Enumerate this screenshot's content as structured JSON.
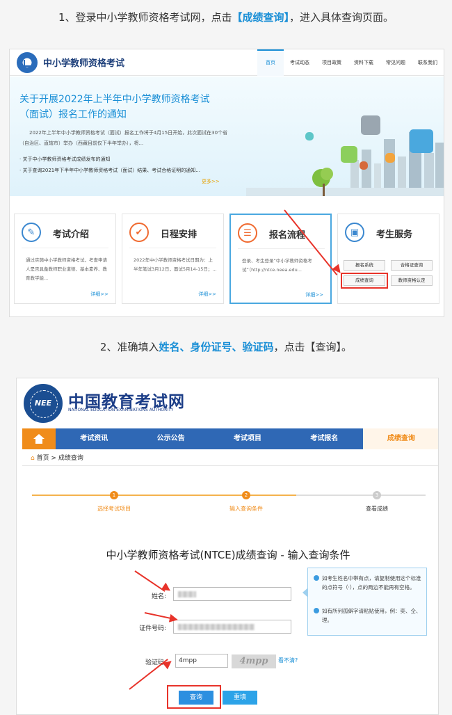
{
  "instructions": {
    "step1_prefix": "1、登录中小学教师资格考试网，点击",
    "step1_highlight": "【成绩查询】",
    "step1_suffix": "，进入具体查询页面。",
    "step2_prefix": "2、准确填入",
    "step2_name": "姓名",
    "step2_sep1": "、",
    "step2_id": "身份证号",
    "step2_sep2": "、",
    "step2_captcha": "验证码",
    "step2_suffix": "，点击【查询】。"
  },
  "shot1": {
    "site_title": "中小学教师资格考试",
    "nav": [
      "首页",
      "考试动态",
      "项目政策",
      "资料下载",
      "常见问题",
      "联系我们"
    ],
    "headline": "关于开展2022年上半年中小学教师资格考试（面试）报名工作的通知",
    "desc": "2022年上半年中小学教师资格考试（面试）报名工作将于4月15日开始，此次面试在30个省（自治区、直辖市）举办（西藏目前仅下半年举办），将...",
    "news": [
      "· 关于中小学教师资格考试成绩发布的通知",
      "· 关于查询2021年下半年中小学教师资格考试（面试）结果、考试合格证明的通知..."
    ],
    "more": "更多>>",
    "cards": [
      {
        "title": "考试介绍",
        "desc": "通过实施中小学教师资格考试，考查申请人是否具备教师职业道德、基本素养、教育教学能...",
        "more": "详细>>"
      },
      {
        "title": "日程安排",
        "desc": "2022年中小学教师资格考试日期为：上半年笔试3月12日，面试5月14-15日；...",
        "more": "详细>>"
      },
      {
        "title": "报名流程",
        "desc": "登录、考生登录“中小学教师资格考试”（http://ntce.neea.edu...",
        "more": "详细>>"
      },
      {
        "title": "考生服务"
      }
    ],
    "services": [
      "报名系统",
      "合格证查询",
      "成绩查询",
      "教师资格认定"
    ]
  },
  "shot2": {
    "brand": "中国教育考试网",
    "brand_en": "NATIONAL EDUCATION EXAMINATIONS AUTHORITY",
    "emblem_text": "NEE",
    "nav": [
      "考试资讯",
      "公示公告",
      "考试项目",
      "考试报名",
      "成绩查询"
    ],
    "breadcrumb_home": "首页",
    "breadcrumb_current": "成绩查询",
    "steps": [
      {
        "num": "1",
        "label": "选择考试项目"
      },
      {
        "num": "2",
        "label": "输入查询条件"
      },
      {
        "num": "3",
        "label": "查看成绩"
      }
    ],
    "form_title": "中小学教师资格考试(NTCE)成绩查询 - 输入查询条件",
    "labels": {
      "name": "姓名:",
      "id": "证件号码:",
      "captcha": "验证码:"
    },
    "captcha_value": "4mpp",
    "captcha_image_text": "4mpp",
    "captcha_refresh": "看不清?",
    "tips": [
      "如考生姓名中带有点，请复制使用这个标准的点符号（·），点的两边不能再有空格。",
      "如有所列孤僻字请粘贴使用，例：奕、仝、理。"
    ],
    "buttons": {
      "query": "查询",
      "reset": "重填"
    }
  },
  "colors": {
    "accent": "#1a8fd6",
    "annotation_red": "#e8332a",
    "nav_blue": "#2f68b5",
    "orange": "#f08c1a"
  }
}
